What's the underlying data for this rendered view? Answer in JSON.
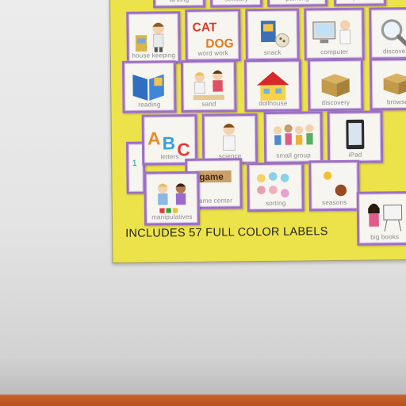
{
  "caption": "INCLUDES 57 FULL COLOR LABELS",
  "labels": {
    "writing": "writing",
    "sensory": "sensory",
    "painting": "painting",
    "special": "special",
    "housekeeping": "house keeping",
    "wordwork": "word work",
    "snack": "snack",
    "computer": "computer",
    "discovery": "discovery",
    "reading": "reading",
    "sand": "sand",
    "dollhouse": "dollhouse",
    "discovery2": "discovery",
    "browse": "browse",
    "letters": "letters",
    "science": "science",
    "smallgroup": "small group",
    "ipad": "iPad",
    "game": "game center",
    "sorting": "sorting",
    "seasons": "seasons",
    "manipulatives": "manipulatives",
    "bigbooks": "big books"
  },
  "art_text": {
    "cat": "CAT",
    "dog": "DOG",
    "abc_a": "A",
    "abc_b": "B",
    "abc_c": "C",
    "game_tiles": "game",
    "number": "1"
  },
  "colors": {
    "board": "#ece34a",
    "card_border": "#9d6fc4",
    "floor": "#c9602c"
  }
}
